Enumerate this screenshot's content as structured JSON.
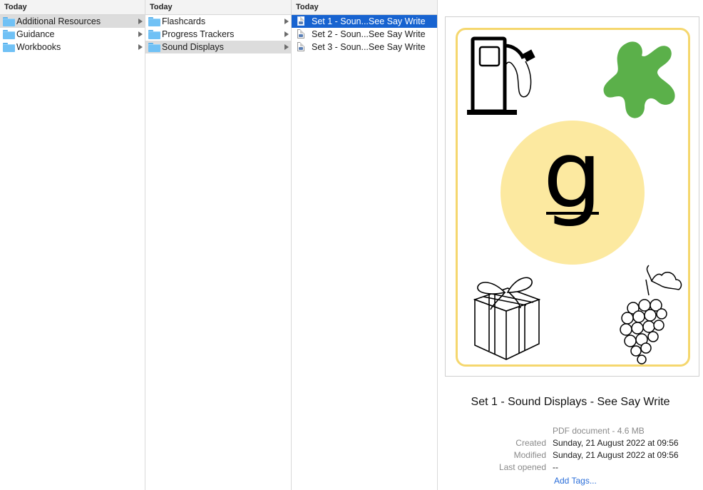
{
  "columns": [
    {
      "header": "Today",
      "items": [
        {
          "label": "Additional Resources",
          "type": "folder",
          "state": "selected-inactive"
        },
        {
          "label": "Guidance",
          "type": "folder"
        },
        {
          "label": "Workbooks",
          "type": "folder"
        }
      ]
    },
    {
      "header": "Today",
      "items": [
        {
          "label": "Flashcards",
          "type": "folder"
        },
        {
          "label": "Progress Trackers",
          "type": "folder"
        },
        {
          "label": "Sound Displays",
          "type": "folder",
          "state": "selected-inactive"
        }
      ]
    },
    {
      "header": "Today",
      "items": [
        {
          "label": "Set 1 - Soun...See Say Write",
          "type": "pdf",
          "state": "selected-active"
        },
        {
          "label": "Set 2 - Soun...See Say Write",
          "type": "pdf"
        },
        {
          "label": "Set 3 - Soun...See Say Write",
          "type": "pdf"
        }
      ]
    }
  ],
  "preview": {
    "letter": "g",
    "title": "Set 1 - Sound Displays - See Say Write",
    "kind": "PDF document - 4.6 MB",
    "created_label": "Created",
    "created_value": "Sunday, 21 August 2022 at 09:56",
    "modified_label": "Modified",
    "modified_value": "Sunday, 21 August 2022 at 09:56",
    "opened_label": "Last opened",
    "opened_value": "--",
    "add_tags": "Add Tags..."
  },
  "colors": {
    "selection_active": "#1763d0",
    "selection_inactive": "#dcdcdc",
    "folder": "#70c1f5",
    "card_border": "#f5d76e",
    "circle": "#fce9a0",
    "splat": "#5bb04a",
    "link": "#2a6ed9"
  },
  "icons": [
    "folder-icon",
    "pdf-file-icon",
    "chevron-right-icon",
    "fuel-pump-icon",
    "splat-icon",
    "gift-icon",
    "grapes-icon"
  ]
}
